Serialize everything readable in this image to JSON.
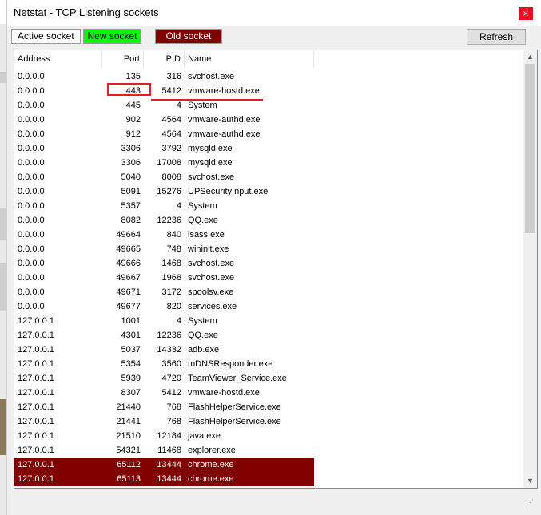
{
  "window": {
    "title": "Netstat - TCP Listening sockets",
    "close_glyph": "×"
  },
  "legend": {
    "active": "Active socket",
    "new": "New socket",
    "old": "Old socket"
  },
  "toolbar": {
    "refresh_label": "Refresh"
  },
  "colors": {
    "new_socket": "#00ff00",
    "old_socket": "#800000",
    "annotation": "#e02020"
  },
  "columns": [
    {
      "label": "Address"
    },
    {
      "label": "Port"
    },
    {
      "label": "PID"
    },
    {
      "label": "Name"
    }
  ],
  "rows": [
    {
      "address": "0.0.0.0",
      "port": "135",
      "pid": "316",
      "name": "svchost.exe",
      "state": "active"
    },
    {
      "address": "0.0.0.0",
      "port": "443",
      "pid": "5412",
      "name": "vmware-hostd.exe",
      "state": "active"
    },
    {
      "address": "0.0.0.0",
      "port": "445",
      "pid": "4",
      "name": "System",
      "state": "active"
    },
    {
      "address": "0.0.0.0",
      "port": "902",
      "pid": "4564",
      "name": "vmware-authd.exe",
      "state": "active"
    },
    {
      "address": "0.0.0.0",
      "port": "912",
      "pid": "4564",
      "name": "vmware-authd.exe",
      "state": "active"
    },
    {
      "address": "0.0.0.0",
      "port": "3306",
      "pid": "3792",
      "name": "mysqld.exe",
      "state": "active"
    },
    {
      "address": "0.0.0.0",
      "port": "3306",
      "pid": "17008",
      "name": "mysqld.exe",
      "state": "active"
    },
    {
      "address": "0.0.0.0",
      "port": "5040",
      "pid": "8008",
      "name": "svchost.exe",
      "state": "active"
    },
    {
      "address": "0.0.0.0",
      "port": "5091",
      "pid": "15276",
      "name": "UPSecurityInput.exe",
      "state": "active"
    },
    {
      "address": "0.0.0.0",
      "port": "5357",
      "pid": "4",
      "name": "System",
      "state": "active"
    },
    {
      "address": "0.0.0.0",
      "port": "8082",
      "pid": "12236",
      "name": "QQ.exe",
      "state": "active"
    },
    {
      "address": "0.0.0.0",
      "port": "49664",
      "pid": "840",
      "name": "lsass.exe",
      "state": "active"
    },
    {
      "address": "0.0.0.0",
      "port": "49665",
      "pid": "748",
      "name": "wininit.exe",
      "state": "active"
    },
    {
      "address": "0.0.0.0",
      "port": "49666",
      "pid": "1468",
      "name": "svchost.exe",
      "state": "active"
    },
    {
      "address": "0.0.0.0",
      "port": "49667",
      "pid": "1968",
      "name": "svchost.exe",
      "state": "active"
    },
    {
      "address": "0.0.0.0",
      "port": "49671",
      "pid": "3172",
      "name": "spoolsv.exe",
      "state": "active"
    },
    {
      "address": "0.0.0.0",
      "port": "49677",
      "pid": "820",
      "name": "services.exe",
      "state": "active"
    },
    {
      "address": "127.0.0.1",
      "port": "1001",
      "pid": "4",
      "name": "System",
      "state": "active"
    },
    {
      "address": "127.0.0.1",
      "port": "4301",
      "pid": "12236",
      "name": "QQ.exe",
      "state": "active"
    },
    {
      "address": "127.0.0.1",
      "port": "5037",
      "pid": "14332",
      "name": "adb.exe",
      "state": "active"
    },
    {
      "address": "127.0.0.1",
      "port": "5354",
      "pid": "3560",
      "name": "mDNSResponder.exe",
      "state": "active"
    },
    {
      "address": "127.0.0.1",
      "port": "5939",
      "pid": "4720",
      "name": "TeamViewer_Service.exe",
      "state": "active"
    },
    {
      "address": "127.0.0.1",
      "port": "8307",
      "pid": "5412",
      "name": "vmware-hostd.exe",
      "state": "active"
    },
    {
      "address": "127.0.0.1",
      "port": "21440",
      "pid": "768",
      "name": "FlashHelperService.exe",
      "state": "active"
    },
    {
      "address": "127.0.0.1",
      "port": "21441",
      "pid": "768",
      "name": "FlashHelperService.exe",
      "state": "active"
    },
    {
      "address": "127.0.0.1",
      "port": "21510",
      "pid": "12184",
      "name": "java.exe",
      "state": "active"
    },
    {
      "address": "127.0.0.1",
      "port": "54321",
      "pid": "11468",
      "name": "explorer.exe",
      "state": "active"
    },
    {
      "address": "127.0.0.1",
      "port": "65112",
      "pid": "13444",
      "name": "chrome.exe",
      "state": "old"
    },
    {
      "address": "127.0.0.1",
      "port": "65113",
      "pid": "13444",
      "name": "chrome.exe",
      "state": "old"
    }
  ],
  "scrollbar": {
    "up_glyph": "▲",
    "down_glyph": "▼"
  }
}
